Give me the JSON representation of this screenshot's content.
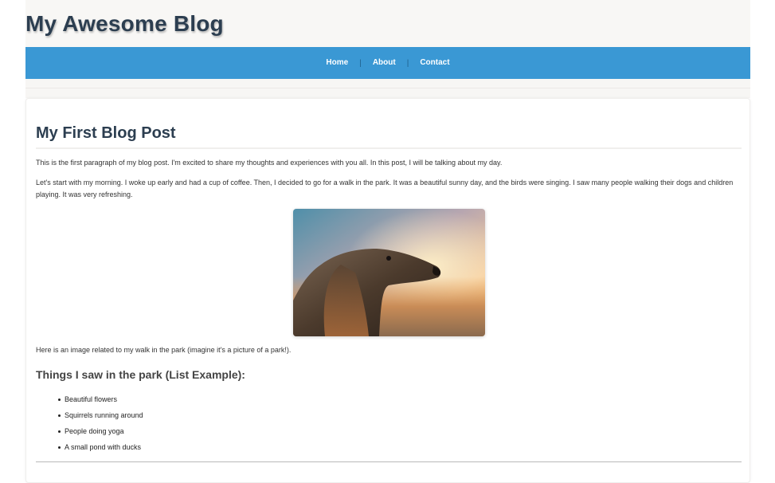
{
  "site": {
    "title": "My Awesome Blog"
  },
  "nav": {
    "items": [
      {
        "label": "Home"
      },
      {
        "label": "About"
      },
      {
        "label": "Contact"
      }
    ],
    "separator": "|",
    "color": "#3a98d4"
  },
  "post": {
    "title": "My First Blog Post",
    "paragraphs": [
      "This is the first paragraph of my blog post. I'm excited to share my thoughts and experiences with you all. In this post, I will be talking about my day.",
      "Let's start with my morning. I woke up early and had a cup of coffee. Then, I decided to go for a walk in the park. It was a beautiful sunny day, and the birds were singing. I saw many people walking their dogs and children playing. It was very refreshing."
    ],
    "image": {
      "subject": "dog-profile-sunset"
    },
    "caption": "Here is an image related to my walk in the park (imagine it's a picture of a park!).",
    "list_heading": "Things I saw in the park (List Example):",
    "list_items": [
      "Beautiful flowers",
      "Squirrels running around",
      "People doing yoga",
      "A small pond with ducks"
    ]
  },
  "colors": {
    "heading": "#2c3e50",
    "header_bg": "#f8f7f5"
  }
}
